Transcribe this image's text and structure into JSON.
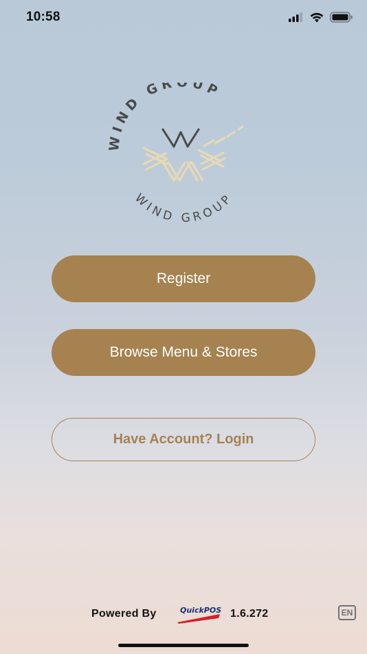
{
  "status_bar": {
    "time": "10:58",
    "icons": [
      "cellular-signal-icon",
      "wifi-icon",
      "battery-icon"
    ]
  },
  "logo": {
    "text_top": "WIND GROUP",
    "text_bottom": "WIND GROUP",
    "colors": {
      "dark": "#4a4a4a",
      "accent": "#e7d9b4"
    }
  },
  "buttons": {
    "register_label": "Register",
    "browse_label": "Browse Menu & Stores",
    "login_label": "Have Account? Login"
  },
  "footer": {
    "powered_by": "Powered By",
    "brand": "QuickPOS",
    "version": "1.6.272",
    "language": "EN"
  },
  "theme": {
    "accent": "#a58250",
    "button_text": "#ffffff"
  }
}
